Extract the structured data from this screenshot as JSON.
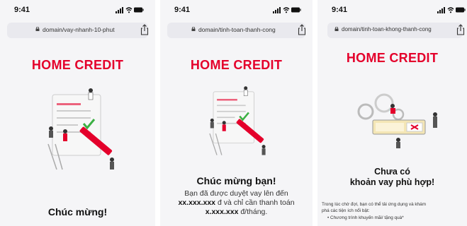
{
  "screens": [
    {
      "time": "9:41",
      "url": "domain/vay-nhanh-10-phut",
      "logo": "HOME CREDIT",
      "title": "Chúc mừng!"
    },
    {
      "time": "9:41",
      "url": "domain/tinh-toan-thanh-cong",
      "logo": "HOME CREDIT",
      "title": "Chúc mừng bạn!",
      "body_line1": "Bạn đã được duyệt vay lên đến",
      "amount": "xx.xxx.xxx",
      "body_line2_rest": " đ và chỉ cần thanh toán",
      "monthly_amount": "x.xxx.xxx",
      "body_line3_rest": " đ/tháng."
    },
    {
      "time": "9:41",
      "url": "domain/tinh-toan-khong-thanh-cong",
      "logo": "HOME CREDIT",
      "title_line1": "Chưa có",
      "title_line2": "khoản vay phù hợp!",
      "body_line1": "Trong lúc chờ đợi, bạn có thể tải ứng dụng và khám",
      "body_line2": "phá các tiện ích nổi bật:",
      "bullet1": "•   Chương trình khuyến mãi/ tặng quà*"
    }
  ],
  "colors": {
    "brand_red": "#e4002b",
    "urlbar_bg": "#e9e9ee",
    "page_bg": "#f5f5f7"
  },
  "icons": [
    "signal-icon",
    "wifi-icon",
    "battery-icon",
    "lock-icon",
    "share-icon"
  ]
}
